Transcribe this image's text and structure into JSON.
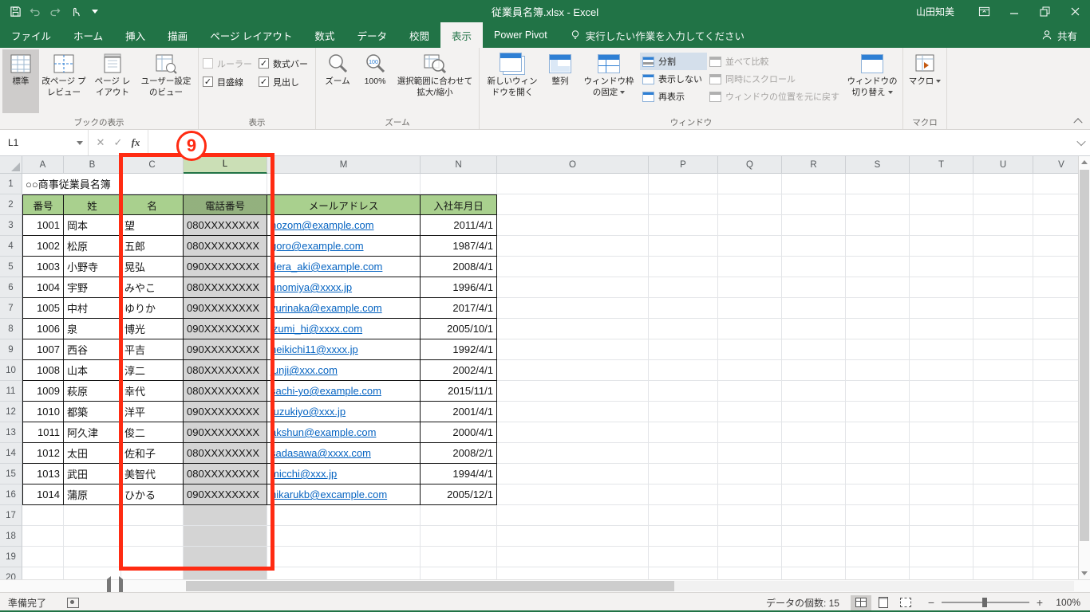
{
  "window": {
    "title": "従業員名簿.xlsx  -  Excel",
    "user": "山田知美"
  },
  "ribbon": {
    "tabs": [
      "ファイル",
      "ホーム",
      "挿入",
      "描画",
      "ページ レイアウト",
      "数式",
      "データ",
      "校閲",
      "表示",
      "Power Pivot"
    ],
    "active_tab": "表示",
    "tell_me": "実行したい作業を入力してください",
    "share": "共有",
    "book_views": {
      "label": "ブックの表示",
      "normal": "標準",
      "page_break": "改ページ プレビュー",
      "page_layout": "ページ レイアウト",
      "custom_views": "ユーザー設定のビュー"
    },
    "show": {
      "label": "表示",
      "ruler": "ルーラー",
      "formula_bar": "数式バー",
      "gridlines": "目盛線",
      "headings": "見出し"
    },
    "zoom": {
      "label": "ズーム",
      "zoom": "ズーム",
      "hundred": "100%",
      "to_selection": "選択範囲に合わせて拡大/縮小"
    },
    "window_group": {
      "label": "ウィンドウ",
      "new_window": "新しいウィンドウを開く",
      "arrange": "整列",
      "freeze": "ウィンドウ枠の固定",
      "split": "分割",
      "hide": "表示しない",
      "unhide": "再表示",
      "side_by_side": "並べて比較",
      "sync_scroll": "同時にスクロール",
      "reset_position": "ウィンドウの位置を元に戻す",
      "switch": "ウィンドウの切り替え"
    },
    "macro_group": {
      "label": "マクロ",
      "macros": "マクロ"
    }
  },
  "formula_bar": {
    "name_box": "L1",
    "value": ""
  },
  "sheet": {
    "visible_columns": [
      "A",
      "B",
      "C",
      "L",
      "M",
      "N",
      "O",
      "P",
      "Q",
      "R",
      "S",
      "T",
      "U",
      "V"
    ],
    "selected_column": "L",
    "active_cell": "L1",
    "title_cell": {
      "ref": "A1",
      "text": "○○商事従業員名簿"
    },
    "header_row": [
      "番号",
      "姓",
      "名",
      "電話番号",
      "メールアドレス",
      "入社年月日"
    ],
    "records": [
      [
        "1001",
        "岡本",
        "望",
        "080XXXXXXXX",
        "nozom@example.com",
        "2011/4/1"
      ],
      [
        "1002",
        "松原",
        "五郎",
        "080XXXXXXXX",
        "goro@example.com",
        "1987/4/1"
      ],
      [
        "1003",
        "小野寺",
        "晃弘",
        "090XXXXXXXX",
        "dera_aki@example.com",
        "2008/4/1"
      ],
      [
        "1004",
        "宇野",
        "みやこ",
        "080XXXXXXXX",
        "unomiya@xxxx.jp",
        "1996/4/1"
      ],
      [
        "1005",
        "中村",
        "ゆりか",
        "090XXXXXXXX",
        "yurinaka@example.com",
        "2017/4/1"
      ],
      [
        "1006",
        "泉",
        "博光",
        "090XXXXXXXX",
        "izumi_hi@xxxx.com",
        "2005/10/1"
      ],
      [
        "1007",
        "西谷",
        "平吉",
        "090XXXXXXXX",
        "heikichi11@xxxx.jp",
        "1992/4/1"
      ],
      [
        "1008",
        "山本",
        "淳二",
        "080XXXXXXXX",
        "junji@xxx.com",
        "2002/4/1"
      ],
      [
        "1009",
        "萩原",
        "幸代",
        "080XXXXXXXX",
        "sachi-yo@example.com",
        "2015/11/1"
      ],
      [
        "1010",
        "都築",
        "洋平",
        "090XXXXXXXX",
        "tuzukiyo@xxx.jp",
        "2001/4/1"
      ],
      [
        "1011",
        "阿久津",
        "俊二",
        "090XXXXXXXX",
        "akshun@example.com",
        "2000/4/1"
      ],
      [
        "1012",
        "太田",
        "佐和子",
        "080XXXXXXXX",
        "sadasawa@xxxx.com",
        "2008/2/1"
      ],
      [
        "1013",
        "武田",
        "美智代",
        "080XXXXXXXX",
        "micchi@xxx.jp",
        "1994/4/1"
      ],
      [
        "1014",
        "蒲原",
        "ひかる",
        "090XXXXXXXX",
        "hikarukb@excample.com",
        "2005/12/1"
      ]
    ]
  },
  "annotations": {
    "step": "9"
  },
  "status_bar": {
    "mode": "準備完了",
    "count_label": "データの個数: 15",
    "zoom_level": "100%"
  },
  "colors": {
    "accent": "#217346",
    "annotation": "#ff2b12",
    "hyperlink": "#0563c1",
    "table_header_fill": "#a9d08e"
  }
}
